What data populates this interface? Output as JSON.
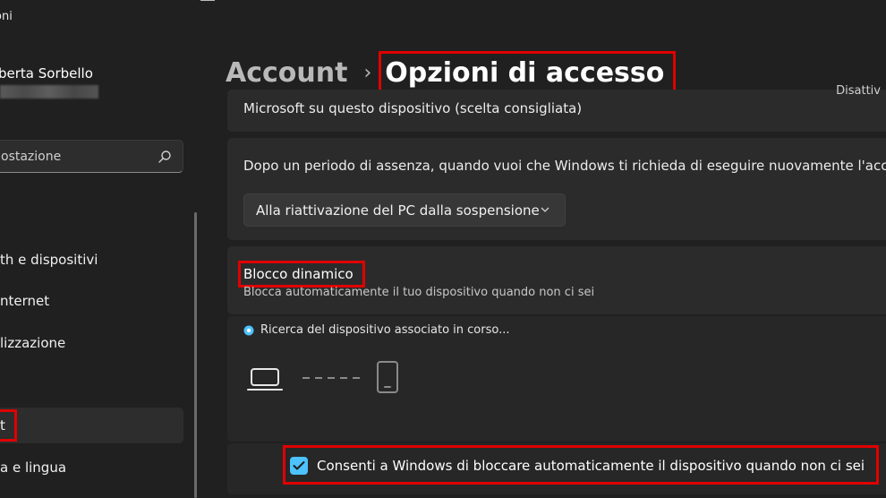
{
  "window": {
    "title": "oni"
  },
  "sidebar": {
    "user_name": "berta Sorbello",
    "search": {
      "value": "",
      "placeholder": "ostazione"
    },
    "items": [
      {
        "label": "th e dispositivi",
        "selected": false
      },
      {
        "label": "nternet",
        "selected": false
      },
      {
        "label": "lizzazione",
        "selected": false
      },
      {
        "label": "t",
        "selected": true
      },
      {
        "label": "a e lingua",
        "selected": false
      }
    ]
  },
  "header": {
    "breadcrumb_parent": "Account",
    "breadcrumb_separator": "›",
    "page_title": "Opzioni di accesso"
  },
  "settings": {
    "top_card_text": "Microsoft su questo dispositivo (scelta consigliata)",
    "top_card_right": "Disattiv",
    "absence": {
      "question": "Dopo un periodo di assenza, quando vuoi che Windows ti richieda di eseguire nuovamente l'accesso?",
      "dropdown_value": "Alla riattivazione del PC dalla sospensione"
    },
    "dynamic_lock": {
      "title": "Blocco dinamico",
      "description": "Blocca automaticamente il tuo dispositivo quando non ci sei",
      "status": "Ricerca del dispositivo associato in corso...",
      "checkbox_label": "Consenti a Windows di bloccare automaticamente il dispositivo quando non ci sei",
      "checkbox_checked": true
    }
  },
  "colors": {
    "accent": "#4cc2ff",
    "highlight": "#e00000",
    "background": "#202020",
    "card": "#2b2b2b"
  },
  "icons": {
    "search": "search-icon",
    "chevron": "chevron-down-icon",
    "status": "info-icon",
    "laptop": "laptop-icon",
    "phone": "phone-icon",
    "check": "checkmark-icon"
  }
}
